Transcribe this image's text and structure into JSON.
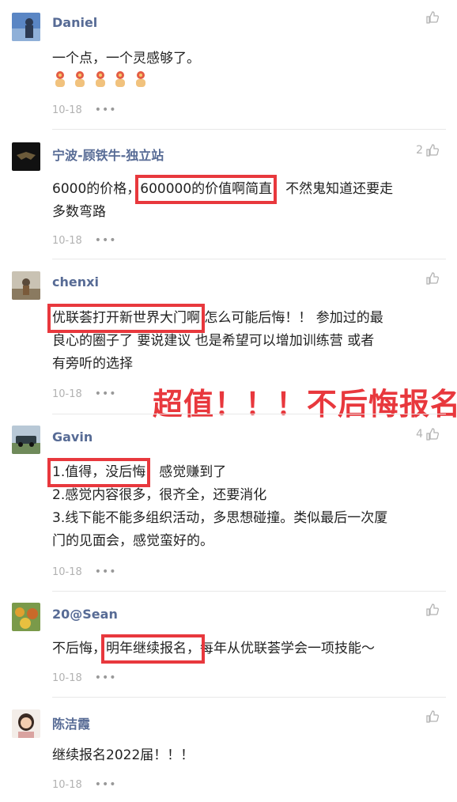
{
  "accent": "#576b95",
  "highlight_color": "#e8383d",
  "annotation": "超值！！！不后悔报名",
  "comments": [
    {
      "name": "Daniel",
      "likes": "",
      "lines": [
        "一个点，一个灵感够了。"
      ],
      "emoji": "fist-bump-emoji x5",
      "date": "10-18"
    },
    {
      "name": "宁波-顾铁牛-独立站",
      "likes": "2",
      "line1_pre": "6000的价格，",
      "line1_hl": "600000的价值啊简直",
      "line1_post": "，不然鬼知道还要走",
      "line2": "多数弯路",
      "date": "10-18"
    },
    {
      "name": "chenxi",
      "likes": "",
      "line1_hl": "优联荟打开新世界大门啊",
      "line1_post": " 怎么可能后悔！！ 参加过的最",
      "line2": "良心的圈子了 要说建议 也是希望可以增加训练营 或者",
      "line3": "有旁听的选择",
      "date": "10-18"
    },
    {
      "name": "Gavin",
      "likes": "4",
      "line1_hl": "1.值得，没后悔",
      "line1_post": "，感觉赚到了",
      "line2": "2.感觉内容很多，很齐全，还要消化",
      "line3": "3.线下能不能多组织活动，多思想碰撞。类似最后一次厦",
      "line4": "门的见面会，感觉蛮好的。",
      "date": "10-18"
    },
    {
      "name": "20@Sean",
      "likes": "",
      "line1_pre": "不后悔，",
      "line1_hl": "明年继续报名，",
      "line1_post": "每年从优联荟学会一项技能～",
      "date": "10-18"
    },
    {
      "name": "陈洁霞",
      "likes": "",
      "line1": "继续报名2022届！！！",
      "date": "10-18"
    }
  ],
  "more_label": "•••"
}
